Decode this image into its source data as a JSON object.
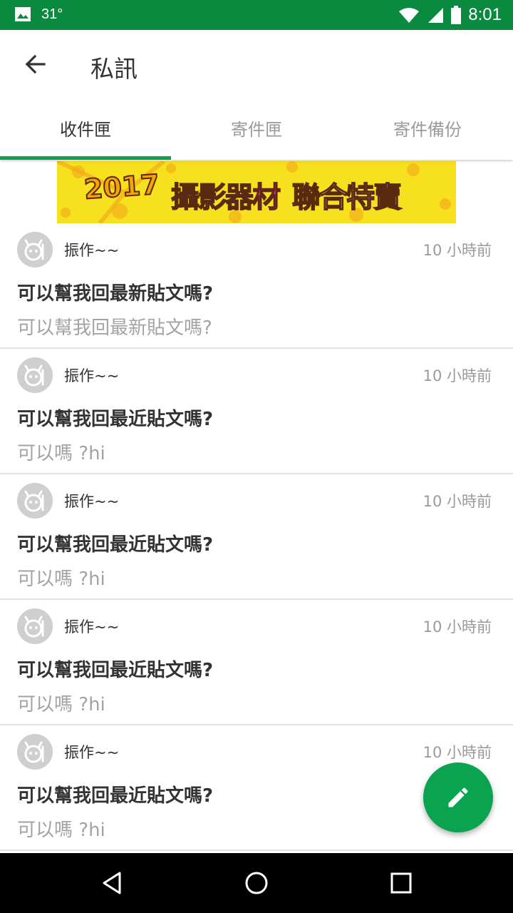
{
  "status_bar": {
    "temperature": "31°",
    "time": "8:01"
  },
  "app_bar": {
    "title": "私訊"
  },
  "tabs": [
    {
      "label": "收件匣",
      "active": true
    },
    {
      "label": "寄件匣",
      "active": false
    },
    {
      "label": "寄件備份",
      "active": false
    }
  ],
  "banner": {
    "year": "2017",
    "text_pink": "攝影器材",
    "text_white": "聯合特賣"
  },
  "messages": [
    {
      "sender": "振作~~",
      "time": "10 小時前",
      "subject": "可以幫我回最新貼文嗎?",
      "preview": "可以幫我回最新貼文嗎?"
    },
    {
      "sender": "振作~~",
      "time": "10 小時前",
      "subject": "可以幫我回最近貼文嗎?",
      "preview": "可以嗎 ?hi"
    },
    {
      "sender": "振作~~",
      "time": "10 小時前",
      "subject": "可以幫我回最近貼文嗎?",
      "preview": "可以嗎 ?hi"
    },
    {
      "sender": "振作~~",
      "time": "10 小時前",
      "subject": "可以幫我回最近貼文嗎?",
      "preview": "可以嗎 ?hi"
    },
    {
      "sender": "振作~~",
      "time": "10 小時前",
      "subject": "可以幫我回最近貼文嗎?",
      "preview": "可以嗎 ?hi"
    }
  ],
  "colors": {
    "status_bar": "#0a8a3f",
    "accent": "#0aa34f",
    "banner_bg": "#f7e01e",
    "banner_pink": "#e0237e"
  },
  "icons": {
    "back": "arrow-left-icon",
    "compose": "pencil-icon",
    "avatar": "robot-face-icon"
  }
}
